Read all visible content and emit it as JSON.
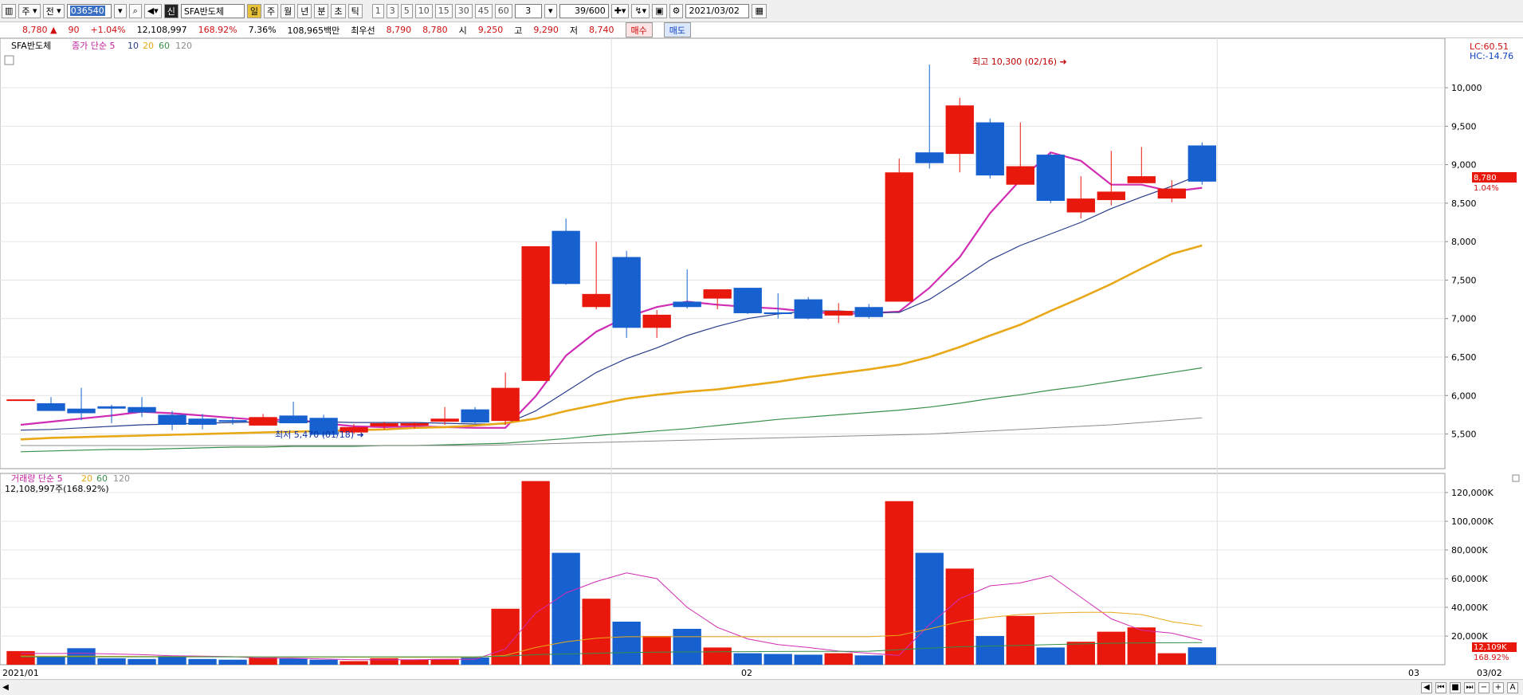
{
  "toolbar": {
    "type_select": "주",
    "view_select": "전",
    "code": "036540",
    "badge": "신",
    "name": "SFA반도체",
    "periods": [
      "일",
      "주",
      "월",
      "년",
      "분",
      "초",
      "틱"
    ],
    "active_period": "일",
    "intervals": [
      "1",
      "3",
      "5",
      "10",
      "15",
      "30",
      "45",
      "60"
    ],
    "custom_interval": "3",
    "count": "39/600",
    "date": "2021/03/02"
  },
  "info": {
    "price": "8,780",
    "change": "90",
    "change_pct": "+1.04%",
    "volume": "12,108,997",
    "volume_ratio": "168.92%",
    "turnover": "7.36%",
    "amount": "108,965백만",
    "best_ask_label": "최우선",
    "best_ask": "8,790",
    "best_bid": "8,780",
    "open_label": "시",
    "open": "9,250",
    "high_label": "고",
    "high": "9,290",
    "low_label": "저",
    "low": "8,740",
    "buy_label": "매수",
    "sell_label": "매도"
  },
  "colors": {
    "up": "#e8180c",
    "down": "#1660d0",
    "ma5": "#d02cb4",
    "ma10": "#283c8c",
    "ma20": "#e8a818",
    "ma60": "#38904a",
    "ma120": "#8c8c8c"
  },
  "chart_data": [
    {
      "type": "candlestick",
      "title": "SFA반도체",
      "legend": {
        "price_label": "종가",
        "method": "단순",
        "periods": [
          "5",
          "10",
          "20",
          "60",
          "120"
        ]
      },
      "right_labels": {
        "lc": "LC:60.51",
        "hc": "HC:-14.76",
        "last_price": "8,780",
        "last_pct": "1.04%"
      },
      "annotations": {
        "high": "최고 10,300 (02/16)",
        "low": "최저 5,470 (01/18)"
      },
      "yticks": [
        5500,
        6000,
        6500,
        7000,
        7500,
        8000,
        8500,
        9000,
        9500,
        10000
      ],
      "ytick_labels": [
        "5,500",
        "6,000",
        "6,500",
        "7,000",
        "7,500",
        "8,000",
        "8,500",
        "9,000",
        "9,500",
        "10,000"
      ],
      "ylim": [
        5050,
        10560
      ],
      "xlabels": [
        "2021/01",
        "02",
        "03"
      ],
      "candles": [
        {
          "o": 5950,
          "h": 5950,
          "l": 5950,
          "c": 5950
        },
        {
          "o": 5900,
          "h": 5980,
          "l": 5820,
          "c": 5800
        },
        {
          "o": 5830,
          "h": 6100,
          "l": 5680,
          "c": 5770
        },
        {
          "o": 5860,
          "h": 5880,
          "l": 5640,
          "c": 5830
        },
        {
          "o": 5850,
          "h": 5980,
          "l": 5720,
          "c": 5780
        },
        {
          "o": 5750,
          "h": 5800,
          "l": 5550,
          "c": 5620
        },
        {
          "o": 5700,
          "h": 5760,
          "l": 5560,
          "c": 5620
        },
        {
          "o": 5680,
          "h": 5720,
          "l": 5620,
          "c": 5660
        },
        {
          "o": 5610,
          "h": 5760,
          "l": 5610,
          "c": 5720
        },
        {
          "o": 5740,
          "h": 5920,
          "l": 5640,
          "c": 5640
        },
        {
          "o": 5710,
          "h": 5750,
          "l": 5470,
          "c": 5490
        },
        {
          "o": 5520,
          "h": 5630,
          "l": 5500,
          "c": 5590
        },
        {
          "o": 5600,
          "h": 5660,
          "l": 5560,
          "c": 5640
        },
        {
          "o": 5610,
          "h": 5650,
          "l": 5570,
          "c": 5640
        },
        {
          "o": 5660,
          "h": 5850,
          "l": 5620,
          "c": 5700
        },
        {
          "o": 5820,
          "h": 5850,
          "l": 5640,
          "c": 5650
        },
        {
          "o": 5670,
          "h": 6300,
          "l": 5620,
          "c": 6100
        },
        {
          "o": 6190,
          "h": 7930,
          "l": 6190,
          "c": 7940
        },
        {
          "o": 8140,
          "h": 8300,
          "l": 7440,
          "c": 7450
        },
        {
          "o": 7150,
          "h": 8000,
          "l": 7120,
          "c": 7320
        },
        {
          "o": 7800,
          "h": 7880,
          "l": 6750,
          "c": 6880
        },
        {
          "o": 6880,
          "h": 7110,
          "l": 6750,
          "c": 7050
        },
        {
          "o": 7220,
          "h": 7640,
          "l": 7130,
          "c": 7150
        },
        {
          "o": 7260,
          "h": 7360,
          "l": 7120,
          "c": 7380
        },
        {
          "o": 7400,
          "h": 7400,
          "l": 7060,
          "c": 7070
        },
        {
          "o": 7080,
          "h": 7330,
          "l": 7000,
          "c": 7070
        },
        {
          "o": 7250,
          "h": 7280,
          "l": 6990,
          "c": 7000
        },
        {
          "o": 7040,
          "h": 7200,
          "l": 6940,
          "c": 7100
        },
        {
          "o": 7150,
          "h": 7190,
          "l": 7000,
          "c": 7020
        },
        {
          "o": 7220,
          "h": 9080,
          "l": 7220,
          "c": 8900
        },
        {
          "o": 9160,
          "h": 10300,
          "l": 8950,
          "c": 9020
        },
        {
          "o": 9140,
          "h": 9870,
          "l": 8900,
          "c": 9770
        },
        {
          "o": 9550,
          "h": 9600,
          "l": 8820,
          "c": 8860
        },
        {
          "o": 8740,
          "h": 9550,
          "l": 8740,
          "c": 8980
        },
        {
          "o": 9130,
          "h": 9150,
          "l": 8500,
          "c": 8530
        },
        {
          "o": 8380,
          "h": 8850,
          "l": 8300,
          "c": 8560
        },
        {
          "o": 8540,
          "h": 9180,
          "l": 8470,
          "c": 8650
        },
        {
          "o": 8760,
          "h": 9230,
          "l": 8760,
          "c": 8850
        },
        {
          "o": 8560,
          "h": 8800,
          "l": 8510,
          "c": 8690
        },
        {
          "o": 9250,
          "h": 9290,
          "l": 8740,
          "c": 8780
        }
      ],
      "ma": [
        {
          "period": "5",
          "values": [
            5620,
            5660,
            5700,
            5740,
            5790,
            5770,
            5740,
            5710,
            5680,
            5690,
            5640,
            5600,
            5590,
            5600,
            5590,
            5580,
            5580,
            5990,
            6520,
            6830,
            7020,
            7150,
            7220,
            7180,
            7150,
            7130,
            7090,
            7060,
            7070,
            7090,
            7400,
            7800,
            8370,
            8800,
            9160,
            9050,
            8740,
            8740,
            8650,
            8700
          ]
        },
        {
          "period": "10",
          "values": [
            5550,
            5560,
            5580,
            5600,
            5620,
            5630,
            5640,
            5650,
            5660,
            5660,
            5660,
            5650,
            5650,
            5650,
            5640,
            5630,
            5630,
            5800,
            6050,
            6300,
            6480,
            6620,
            6780,
            6900,
            7000,
            7060,
            7100,
            7100,
            7080,
            7080,
            7250,
            7500,
            7760,
            7950,
            8100,
            8250,
            8430,
            8580,
            8720,
            8880
          ]
        },
        {
          "period": "20",
          "values": [
            5430,
            5450,
            5460,
            5470,
            5480,
            5490,
            5500,
            5510,
            5520,
            5530,
            5540,
            5550,
            5560,
            5580,
            5590,
            5610,
            5640,
            5700,
            5800,
            5880,
            5960,
            6010,
            6050,
            6080,
            6130,
            6180,
            6240,
            6290,
            6340,
            6400,
            6500,
            6630,
            6780,
            6920,
            7100,
            7270,
            7450,
            7650,
            7840,
            7950
          ]
        },
        {
          "period": "60",
          "values": [
            5270,
            5280,
            5290,
            5300,
            5300,
            5310,
            5320,
            5330,
            5330,
            5340,
            5340,
            5340,
            5350,
            5350,
            5360,
            5370,
            5380,
            5410,
            5440,
            5480,
            5510,
            5540,
            5570,
            5610,
            5650,
            5690,
            5720,
            5750,
            5780,
            5810,
            5850,
            5900,
            5960,
            6010,
            6070,
            6120,
            6180,
            6240,
            6300,
            6360
          ]
        },
        {
          "period": "120",
          "values": [
            5350,
            5350,
            5350,
            5350,
            5350,
            5350,
            5350,
            5350,
            5350,
            5350,
            5350,
            5350,
            5350,
            5350,
            5350,
            5350,
            5360,
            5370,
            5380,
            5390,
            5400,
            5410,
            5420,
            5430,
            5440,
            5450,
            5460,
            5470,
            5480,
            5490,
            5500,
            5520,
            5540,
            5560,
            5580,
            5600,
            5620,
            5650,
            5680,
            5710
          ]
        }
      ]
    },
    {
      "type": "bar",
      "title": "거래량",
      "legend": {
        "method": "단순",
        "periods": [
          "5",
          "20",
          "60",
          "120"
        ]
      },
      "sub_label": "12,108,997주(168.92%)",
      "right_labels": {
        "last_volume": "12,109K",
        "last_pct": "168.92%"
      },
      "yticks": [
        20000,
        40000,
        60000,
        80000,
        100000,
        120000
      ],
      "ytick_labels": [
        "20,000K",
        "40,000K",
        "60,000K",
        "80,000K",
        "100,000K",
        "120,000K"
      ],
      "ylim": [
        0,
        130000
      ],
      "unit": "K",
      "values": [
        9500,
        5500,
        11500,
        4500,
        4000,
        6000,
        4000,
        3500,
        5000,
        4500,
        3500,
        2500,
        4500,
        3500,
        4000,
        5000,
        39000,
        128000,
        78000,
        46000,
        30000,
        20000,
        25000,
        12000,
        8000,
        7500,
        7000,
        8000,
        6500,
        114000,
        78000,
        67000,
        20000,
        34000,
        12000,
        16000,
        23000,
        26000,
        8000,
        12109
      ],
      "ma": [
        {
          "period": "5",
          "values": [
            8000,
            7800,
            8000,
            7500,
            7000,
            6300,
            6000,
            5600,
            4500,
            4500,
            4000,
            3500,
            3500,
            3500,
            3800,
            3800,
            11000,
            36000,
            50000,
            58000,
            64000,
            60000,
            40000,
            26000,
            18000,
            14000,
            12000,
            9500,
            8000,
            6500,
            28000,
            46000,
            55000,
            57000,
            62000,
            47000,
            32000,
            24000,
            22000,
            17000
          ]
        },
        {
          "period": "20",
          "values": [
            6000,
            6000,
            6000,
            5900,
            5800,
            5700,
            5600,
            5500,
            5400,
            5300,
            5300,
            5200,
            5200,
            5100,
            5100,
            5100,
            6500,
            12000,
            16000,
            18500,
            19500,
            19500,
            19500,
            19500,
            19500,
            19500,
            19500,
            19500,
            19500,
            20500,
            25000,
            30000,
            33000,
            35000,
            36000,
            36500,
            36500,
            35000,
            30000,
            27000
          ]
        },
        {
          "period": "60",
          "values": [
            5500,
            5500,
            5500,
            5500,
            5500,
            5500,
            5500,
            5500,
            5500,
            5500,
            5500,
            5500,
            5500,
            5500,
            5500,
            5500,
            6000,
            7000,
            7500,
            8000,
            8500,
            8700,
            8900,
            9000,
            9100,
            9200,
            9300,
            9300,
            9400,
            10500,
            11500,
            12500,
            13000,
            13500,
            14000,
            14500,
            15000,
            15200,
            15300,
            15400
          ]
        }
      ]
    }
  ]
}
